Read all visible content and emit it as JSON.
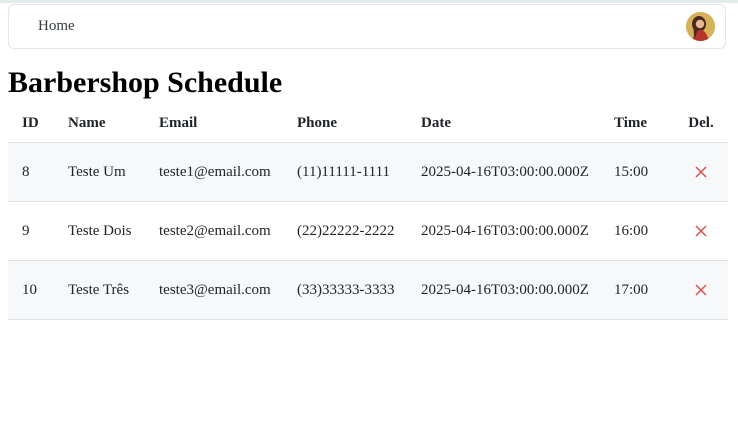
{
  "nav": {
    "home_label": "Home"
  },
  "page": {
    "title": "Barbershop Schedule"
  },
  "table": {
    "headers": {
      "id": "ID",
      "name": "Name",
      "email": "Email",
      "phone": "Phone",
      "date": "Date",
      "time": "Time",
      "del": "Del."
    },
    "rows": [
      {
        "id": "8",
        "name": "Teste Um",
        "email": "teste1@email.com",
        "phone": "(11)11111-1111",
        "date": "2025-04-16T03:00:00.000Z",
        "time": "15:00"
      },
      {
        "id": "9",
        "name": "Teste Dois",
        "email": "teste2@email.com",
        "phone": "(22)22222-2222",
        "date": "2025-04-16T03:00:00.000Z",
        "time": "16:00"
      },
      {
        "id": "10",
        "name": "Teste Três",
        "email": "teste3@email.com",
        "phone": "(33)33333-3333",
        "date": "2025-04-16T03:00:00.000Z",
        "time": "17:00"
      }
    ]
  },
  "icons": {
    "delete": "close-icon",
    "avatar": "user-avatar"
  },
  "colors": {
    "delete_icon": "#d9534f",
    "row_stripe": "#f7f8fa",
    "border": "#dee2e6"
  }
}
